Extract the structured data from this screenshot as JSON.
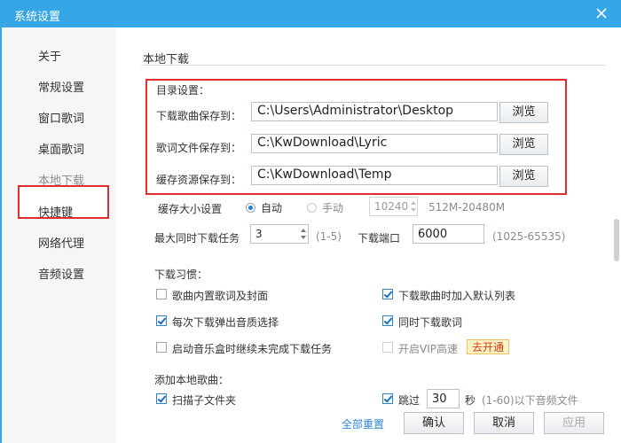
{
  "window": {
    "title": "系统设置"
  },
  "sidebar": {
    "items": [
      {
        "label": "关于"
      },
      {
        "label": "常规设置"
      },
      {
        "label": "窗口歌词"
      },
      {
        "label": "桌面歌词"
      },
      {
        "label": "本地下载"
      },
      {
        "label": "快捷键"
      },
      {
        "label": "网络代理"
      },
      {
        "label": "音频设置"
      }
    ],
    "active_index": 4
  },
  "section": {
    "title": "本地下载"
  },
  "directory": {
    "heading": "目录设置：",
    "rows": [
      {
        "label": "下载歌曲保存到：",
        "value": "C:\\Users\\Administrator\\Desktop",
        "button": "浏览"
      },
      {
        "label": "歌词文件保存到：",
        "value": "C:\\KwDownload\\Lyric",
        "button": "浏览"
      },
      {
        "label": "缓存资源保存到：",
        "value": "C:\\KwDownload\\Temp",
        "button": "浏览"
      }
    ]
  },
  "cache": {
    "label": "缓存大小设置",
    "auto_label": "自动",
    "manual_label": "手动",
    "selected": "自动",
    "size_value": "10240",
    "range": "512M-20480M"
  },
  "concurrency": {
    "label": "最大同时下载任务",
    "value": "3",
    "range": "(1-5)",
    "port_label": "下载端口",
    "port_value": "6000",
    "port_range": "(1025-65535)"
  },
  "habits": {
    "heading": "下载习惯：",
    "options": [
      {
        "label": "歌曲内置歌词及封面",
        "checked": false,
        "disabled": false
      },
      {
        "label": "下载歌曲时加入默认列表",
        "checked": true,
        "disabled": false
      },
      {
        "label": "每次下载弹出音质选择",
        "checked": true,
        "disabled": false
      },
      {
        "label": "同时下载歌词",
        "checked": true,
        "disabled": false
      },
      {
        "label": "启动音乐盒时继续未完成下载任务",
        "checked": false,
        "disabled": false
      },
      {
        "label": "开启VIP高速",
        "checked": false,
        "disabled": true
      }
    ],
    "vip_badge": "去开通"
  },
  "local_add": {
    "heading": "添加本地歌曲：",
    "scan_subfolders_label": "扫描子文件夹",
    "scan_checked": true,
    "skip_label": "跳过",
    "skip_checked": true,
    "skip_seconds": "30",
    "skip_suffix": "秒",
    "skip_range_note": "(1-60)以下音频文件"
  },
  "footer": {
    "reset_label": "全部重置",
    "ok_label": "确认",
    "cancel_label": "取消",
    "apply_label": "应用"
  },
  "colors": {
    "titlebar": "#35a7e6",
    "highlight_box": "#e02e2e",
    "link": "#2e86d4"
  }
}
